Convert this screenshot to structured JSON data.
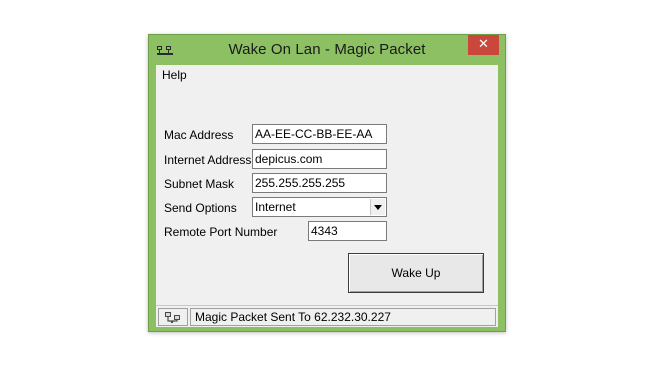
{
  "window": {
    "title": "Wake On Lan - Magic Packet",
    "close_glyph": "✕",
    "app_icon": "network-icon",
    "title_bar_color": "#8dbf63",
    "close_button_color": "#c9483b"
  },
  "menu": {
    "items": [
      {
        "label": "Help"
      }
    ]
  },
  "form": {
    "mac_address": {
      "label": "Mac Address",
      "value": "AA-EE-CC-BB-EE-AA"
    },
    "internet_address": {
      "label": "Internet Address",
      "value": "depicus.com"
    },
    "subnet_mask": {
      "label": "Subnet Mask",
      "value": "255.255.255.255"
    },
    "send_options": {
      "label": "Send Options",
      "selected": "Internet"
    },
    "remote_port": {
      "label": "Remote Port Number",
      "value": "4343"
    }
  },
  "actions": {
    "wake_up_label": "Wake Up"
  },
  "statusbar": {
    "icon": "network-status-icon",
    "message": "Magic Packet Sent To 62.232.30.227"
  }
}
